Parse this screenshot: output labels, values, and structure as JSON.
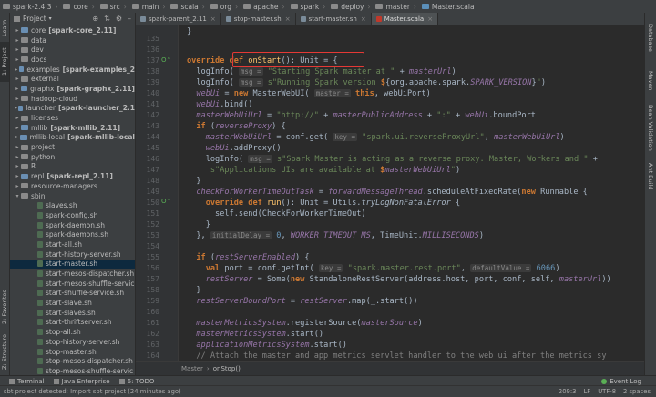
{
  "breadcrumb": [
    "spark-2.4.3",
    "core",
    "src",
    "main",
    "scala",
    "org",
    "apache",
    "spark",
    "deploy",
    "master",
    "Master.scala"
  ],
  "project_panel": {
    "title": "Project",
    "tree": [
      {
        "label": "core",
        "bold": "[spark-core_2.11]",
        "kind": "module",
        "arrow": "▸",
        "indent": 1
      },
      {
        "label": "data",
        "kind": "folder",
        "arrow": "▸",
        "indent": 1
      },
      {
        "label": "dev",
        "kind": "folder",
        "arrow": "▸",
        "indent": 1
      },
      {
        "label": "docs",
        "kind": "folder",
        "arrow": "▸",
        "indent": 1
      },
      {
        "label": "examples",
        "bold": "[spark-examples_2",
        "kind": "module",
        "arrow": "▸",
        "indent": 1
      },
      {
        "label": "external",
        "kind": "folder",
        "arrow": "▸",
        "indent": 1
      },
      {
        "label": "graphx",
        "bold": "[spark-graphx_2.11]",
        "kind": "module",
        "arrow": "▸",
        "indent": 1
      },
      {
        "label": "hadoop-cloud",
        "kind": "folder",
        "arrow": "▸",
        "indent": 1
      },
      {
        "label": "launcher",
        "bold": "[spark-launcher_2.1",
        "kind": "module",
        "arrow": "▸",
        "indent": 1
      },
      {
        "label": "licenses",
        "kind": "folder",
        "arrow": "▸",
        "indent": 1
      },
      {
        "label": "mllib",
        "bold": "[spark-mllib_2.11]",
        "kind": "module",
        "arrow": "▸",
        "indent": 1
      },
      {
        "label": "mllib-local",
        "bold": "[spark-mllib-local",
        "kind": "module",
        "arrow": "▸",
        "indent": 1
      },
      {
        "label": "project",
        "kind": "folder",
        "arrow": "▸",
        "indent": 1
      },
      {
        "label": "python",
        "kind": "folder",
        "arrow": "▸",
        "indent": 1
      },
      {
        "label": "R",
        "kind": "folder",
        "arrow": "▸",
        "indent": 1
      },
      {
        "label": "repl",
        "bold": "[spark-repl_2.11]",
        "kind": "module",
        "arrow": "▸",
        "indent": 1
      },
      {
        "label": "resource-managers",
        "kind": "folder",
        "arrow": "▸",
        "indent": 1
      },
      {
        "label": "sbin",
        "kind": "folder",
        "arrow": "▾",
        "indent": 1
      },
      {
        "label": "slaves.sh",
        "kind": "sh",
        "arrow": "",
        "indent": 2
      },
      {
        "label": "spark-config.sh",
        "kind": "sh",
        "arrow": "",
        "indent": 2
      },
      {
        "label": "spark-daemon.sh",
        "kind": "sh",
        "arrow": "",
        "indent": 2
      },
      {
        "label": "spark-daemons.sh",
        "kind": "sh",
        "arrow": "",
        "indent": 2
      },
      {
        "label": "start-all.sh",
        "kind": "sh",
        "arrow": "",
        "indent": 2
      },
      {
        "label": "start-history-server.sh",
        "kind": "sh",
        "arrow": "",
        "indent": 2
      },
      {
        "label": "start-master.sh",
        "kind": "sh",
        "arrow": "",
        "indent": 2,
        "selected": true
      },
      {
        "label": "start-mesos-dispatcher.sh",
        "kind": "sh",
        "arrow": "",
        "indent": 2
      },
      {
        "label": "start-mesos-shuffle-servic",
        "kind": "sh",
        "arrow": "",
        "indent": 2
      },
      {
        "label": "start-shuffle-service.sh",
        "kind": "sh",
        "arrow": "",
        "indent": 2
      },
      {
        "label": "start-slave.sh",
        "kind": "sh",
        "arrow": "",
        "indent": 2
      },
      {
        "label": "start-slaves.sh",
        "kind": "sh",
        "arrow": "",
        "indent": 2
      },
      {
        "label": "start-thriftserver.sh",
        "kind": "sh",
        "arrow": "",
        "indent": 2
      },
      {
        "label": "stop-all.sh",
        "kind": "sh",
        "arrow": "",
        "indent": 2
      },
      {
        "label": "stop-history-server.sh",
        "kind": "sh",
        "arrow": "",
        "indent": 2
      },
      {
        "label": "stop-master.sh",
        "kind": "sh",
        "arrow": "",
        "indent": 2
      },
      {
        "label": "stop-mesos-dispatcher.sh",
        "kind": "sh",
        "arrow": "",
        "indent": 2
      },
      {
        "label": "stop-mesos-shuffle-servic",
        "kind": "sh",
        "arrow": "",
        "indent": 2
      }
    ]
  },
  "left_tool_tabs": {
    "learn": "Learn",
    "project": "1: Project",
    "favorites": "2: Favorites",
    "structure": "Z: Structure"
  },
  "right_tool_tabs": {
    "database": "Database",
    "maven": "Maven",
    "bean": "Bean Validation",
    "ant": "Ant Build"
  },
  "editor_tabs": [
    {
      "label": "spark-parent_2.11",
      "active": false
    },
    {
      "label": "stop-master.sh",
      "active": false
    },
    {
      "label": "start-master.sh",
      "active": false
    },
    {
      "label": "Master.scala",
      "active": true
    }
  ],
  "line_numbers": [
    "135",
    "136",
    "137",
    "138",
    "139",
    "140",
    "141",
    "142",
    "143",
    "144",
    "145",
    "146",
    "147",
    "148",
    "149",
    "150",
    "151",
    "152",
    "153",
    "154",
    "155",
    "156",
    "157",
    "158",
    "159",
    "160",
    "161",
    "162",
    "163",
    "164",
    "165"
  ],
  "code_breadcrumb": {
    "cls": "Master",
    "method": "onStop()"
  },
  "bottom_tabs": [
    "Terminal",
    "Java Enterprise",
    "6: TODO"
  ],
  "event_log": "Event Log",
  "status": {
    "message": "sbt project detected: Import sbt project (24 minutes ago)",
    "position": "209:3",
    "line_sep": "LF",
    "encoding": "UTF-8",
    "indent": "2 spaces"
  }
}
